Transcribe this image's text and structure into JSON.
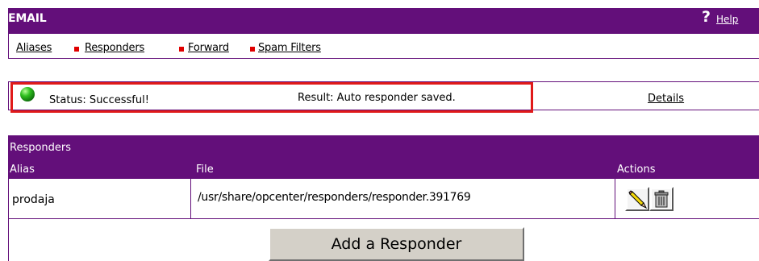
{
  "header": {
    "title": "EMAIL",
    "help_icon": "?",
    "help_label": "Help"
  },
  "nav": {
    "items": [
      "Aliases",
      "Responders",
      "Forward",
      "Spam Filters"
    ]
  },
  "status": {
    "label": "Status: Successful!",
    "result": "Result: Auto responder saved.",
    "details_label": "Details"
  },
  "responders": {
    "title": "Responders",
    "columns": [
      "Alias",
      "File",
      "Actions"
    ],
    "rows": [
      {
        "alias": "prodaja",
        "file": "/usr/share/opcenter/responders/responder.391769"
      }
    ],
    "add_label": "Add a Responder"
  },
  "colors": {
    "brand": "#630f7a",
    "separator": "#e00000",
    "highlight": "#e01a1a"
  },
  "icons": {
    "status": "green-led-icon",
    "edit": "pencil-edit-icon",
    "delete": "trash-can-icon"
  }
}
